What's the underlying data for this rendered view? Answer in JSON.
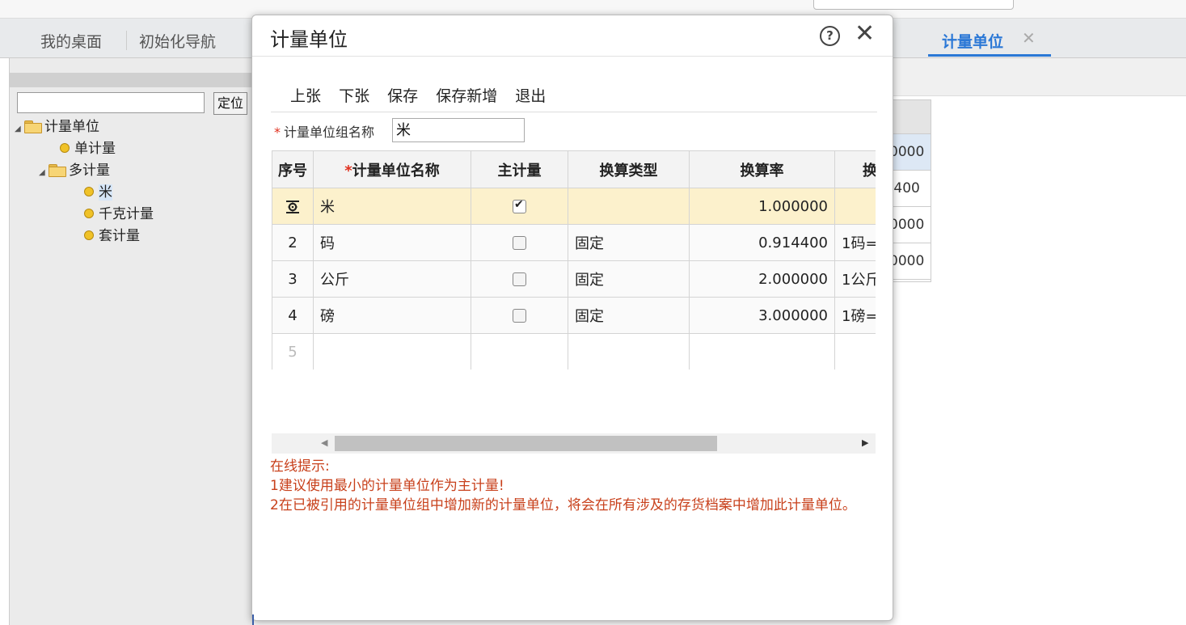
{
  "tabs": {
    "items": [
      "我的桌面",
      "初始化导航"
    ],
    "active": "计量单位",
    "close_glyph": "✕"
  },
  "left_panel": {
    "locate_button": "定位",
    "locate_value": "",
    "tree": {
      "root": "计量单位",
      "single": "单计量",
      "multi": "多计量",
      "multi_children": [
        "米",
        "千克计量",
        "套计量"
      ]
    }
  },
  "background_table": {
    "rows": [
      "0000",
      ".400",
      "0000",
      "0000"
    ]
  },
  "dialog": {
    "title": "计量单位",
    "help_glyph": "?",
    "close_glyph": "✕",
    "toolbar": {
      "prev": "上张",
      "next": "下张",
      "save": "保存",
      "save_new": "保存新增",
      "exit": "退出"
    },
    "group": {
      "required_mark": "*",
      "label": "计量单位组名称",
      "value": "米"
    },
    "grid": {
      "headers": {
        "seq": "序号",
        "name_required_mark": "*",
        "name": "计量单位名称",
        "primary": "主计量",
        "conv_type": "换算类型",
        "conv_rate": "换算率",
        "conv_desc": "换"
      },
      "rows": [
        {
          "seq": "",
          "name": "米",
          "primary": true,
          "conv_type": "",
          "rate": "1.000000",
          "desc": ""
        },
        {
          "seq": "2",
          "name": "码",
          "primary": false,
          "conv_type": "固定",
          "rate": "0.914400",
          "desc": "1码="
        },
        {
          "seq": "3",
          "name": "公斤",
          "primary": false,
          "conv_type": "固定",
          "rate": "2.000000",
          "desc": "1公斤"
        },
        {
          "seq": "4",
          "name": "磅",
          "primary": false,
          "conv_type": "固定",
          "rate": "3.000000",
          "desc": "1磅="
        },
        {
          "seq": "5",
          "name": "",
          "primary": null,
          "conv_type": "",
          "rate": "",
          "desc": ""
        }
      ]
    },
    "hint": {
      "title": "在线提示:",
      "line1": "1建议使用最小的计量单位作为主计量!",
      "line2": "2在已被引用的计量单位组中增加新的计量单位，将会在所有涉及的存货档案中增加此计量单位。"
    }
  }
}
